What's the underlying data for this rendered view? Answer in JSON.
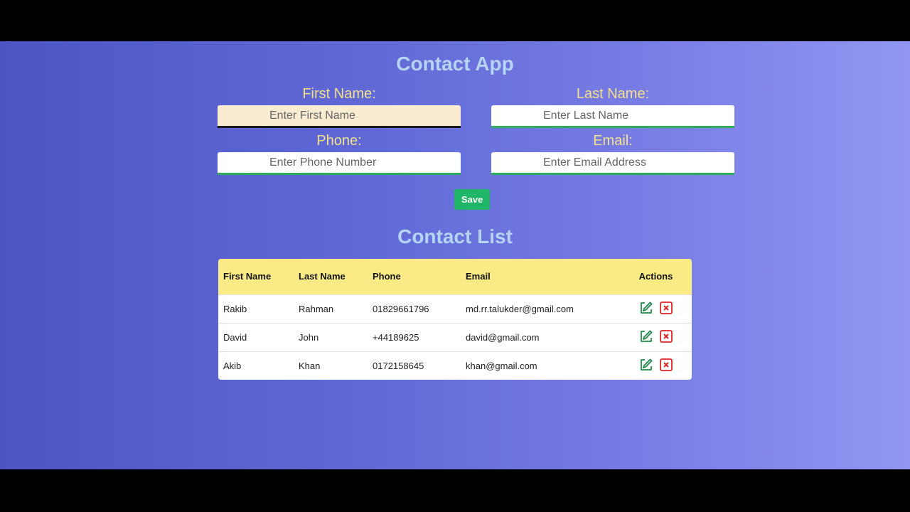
{
  "app": {
    "title": "Contact App"
  },
  "form": {
    "first_name": {
      "label": "First Name:",
      "placeholder": "Enter First Name",
      "value": ""
    },
    "last_name": {
      "label": "Last Name:",
      "placeholder": "Enter Last Name",
      "value": ""
    },
    "phone": {
      "label": "Phone:",
      "placeholder": "Enter Phone Number",
      "value": ""
    },
    "email": {
      "label": "Email:",
      "placeholder": "Enter Email Address",
      "value": ""
    },
    "save_label": "Save"
  },
  "list": {
    "title": "Contact List",
    "columns": [
      "First Name",
      "Last Name",
      "Phone",
      "Email",
      "Actions"
    ],
    "rows": [
      {
        "first": "Rakib",
        "last": "Rahman",
        "phone": "01829661796",
        "email": "md.rr.talukder@gmail.com"
      },
      {
        "first": "David",
        "last": "John",
        "phone": "+44189625",
        "email": "david@gmail.com"
      },
      {
        "first": "Akib",
        "last": "Khan",
        "phone": "0172158645",
        "email": "khan@gmail.com"
      }
    ],
    "actions": {
      "edit_icon": "edit-icon",
      "delete_icon": "delete-icon"
    }
  },
  "colors": {
    "accent_green": "#1fb767",
    "label_yellow": "#f3e08a",
    "title_blue": "#b8d4f5",
    "header_yellow": "#fbeb86",
    "delete_red": "#e02424"
  }
}
